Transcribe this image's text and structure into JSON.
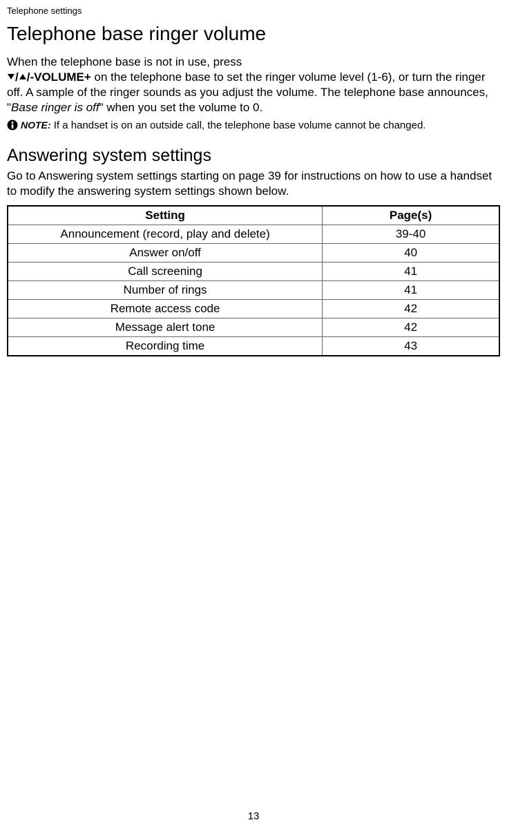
{
  "header": {
    "label": "Telephone settings"
  },
  "section1": {
    "title": "Telephone base ringer volume",
    "para_line1": "When the telephone base is not in use, press",
    "volume_control": "/-VOLUME+",
    "para_part2": " on the telephone base to set the ringer volume level (1-6), or turn the ringer off. A sample of the ringer sounds as you adjust the volume. The telephone base announces, \"",
    "italic_phrase": "Base ringer is off",
    "para_part3": "\" when you set the volume to 0."
  },
  "note": {
    "label": "NOTE:",
    "text": " If a handset is on an outside call, the telephone base volume cannot be changed."
  },
  "section2": {
    "title": "Answering system settings",
    "intro": "Go to Answering system settings starting on page 39 for instructions on how to use a handset to modify the answering system settings shown below.",
    "table": {
      "header_setting": "Setting",
      "header_pages": "Page(s)",
      "rows": [
        {
          "setting": "Announcement (record, play and delete)",
          "pages": "39-40"
        },
        {
          "setting": "Answer on/off",
          "pages": "40"
        },
        {
          "setting": "Call screening",
          "pages": "41"
        },
        {
          "setting": "Number of rings",
          "pages": "41"
        },
        {
          "setting": "Remote access code",
          "pages": "42"
        },
        {
          "setting": "Message alert tone",
          "pages": "42"
        },
        {
          "setting": "Recording time",
          "pages": "43"
        }
      ]
    }
  },
  "page_number": "13"
}
